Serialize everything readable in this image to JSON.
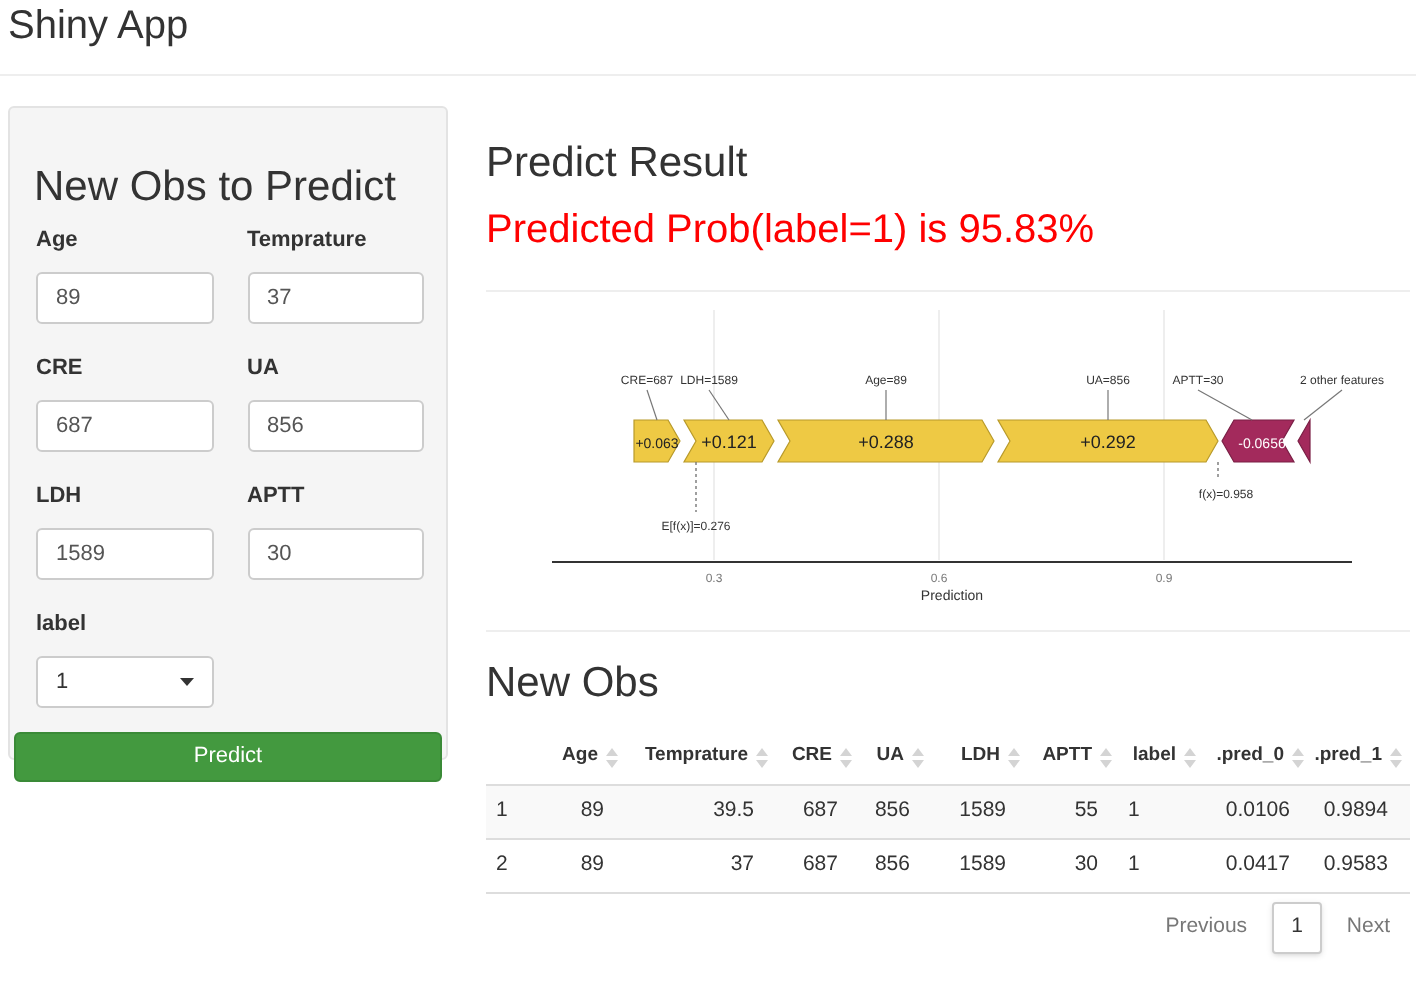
{
  "header": {
    "title": "Shiny App"
  },
  "sidebar": {
    "title": "New Obs to Predict",
    "fields": [
      {
        "label": "Age",
        "value": "89"
      },
      {
        "label": "Temprature",
        "value": "37"
      },
      {
        "label": "CRE",
        "value": "687"
      },
      {
        "label": "UA",
        "value": "856"
      },
      {
        "label": "LDH",
        "value": "1589"
      },
      {
        "label": "APTT",
        "value": "30"
      }
    ],
    "select": {
      "label": "label",
      "value": "1"
    },
    "button": "Predict"
  },
  "result": {
    "title": "Predict Result",
    "text": "Predicted Prob(label=1) is 95.83%"
  },
  "force_plot": {
    "segments": [
      {
        "feature": "CRE=687",
        "value": "+0.063",
        "kind": "positive"
      },
      {
        "feature": "LDH=1589",
        "value": "+0.121",
        "kind": "positive"
      },
      {
        "feature": "Age=89",
        "value": "+0.288",
        "kind": "positive"
      },
      {
        "feature": "UA=856",
        "value": "+0.292",
        "kind": "positive"
      },
      {
        "feature": "APTT=30",
        "value": "-0.0656",
        "kind": "negative"
      },
      {
        "feature": "2 other features",
        "kind": "negative"
      }
    ],
    "base_label": "E[f(x)]=0.276",
    "output_label": "f(x)=0.958",
    "xticks": [
      "0.3",
      "0.6",
      "0.9"
    ],
    "xlabel": "Prediction"
  },
  "table": {
    "title": "New Obs",
    "columns": [
      "",
      "Age",
      "Temprature",
      "CRE",
      "UA",
      "LDH",
      "APTT",
      "label",
      ".pred_0",
      ".pred_1"
    ],
    "rows": [
      [
        "1",
        "89",
        "39.5",
        "687",
        "856",
        "1589",
        "55",
        "1",
        "0.0106",
        "0.9894"
      ],
      [
        "2",
        "89",
        "37",
        "687",
        "856",
        "1589",
        "30",
        "1",
        "0.0417",
        "0.9583"
      ]
    ],
    "pagination": [
      {
        "label": "Previous",
        "selected": false
      },
      {
        "label": "1",
        "selected": true
      },
      {
        "label": "Next",
        "selected": false
      }
    ]
  }
}
